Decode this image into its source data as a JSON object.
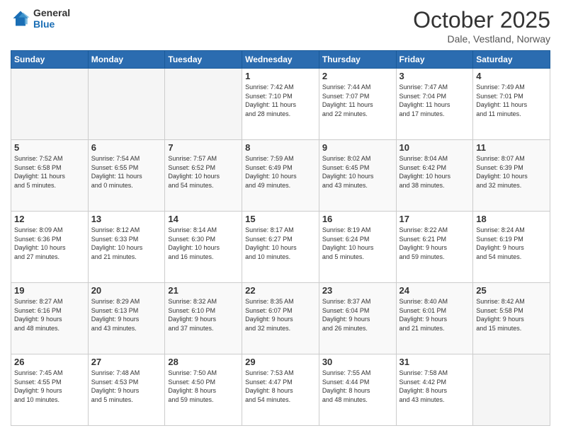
{
  "header": {
    "logo_general": "General",
    "logo_blue": "Blue",
    "main_title": "October 2025",
    "subtitle": "Dale, Vestland, Norway"
  },
  "days_of_week": [
    "Sunday",
    "Monday",
    "Tuesday",
    "Wednesday",
    "Thursday",
    "Friday",
    "Saturday"
  ],
  "weeks": [
    [
      {
        "day": "",
        "info": ""
      },
      {
        "day": "",
        "info": ""
      },
      {
        "day": "",
        "info": ""
      },
      {
        "day": "1",
        "info": "Sunrise: 7:42 AM\nSunset: 7:10 PM\nDaylight: 11 hours\nand 28 minutes."
      },
      {
        "day": "2",
        "info": "Sunrise: 7:44 AM\nSunset: 7:07 PM\nDaylight: 11 hours\nand 22 minutes."
      },
      {
        "day": "3",
        "info": "Sunrise: 7:47 AM\nSunset: 7:04 PM\nDaylight: 11 hours\nand 17 minutes."
      },
      {
        "day": "4",
        "info": "Sunrise: 7:49 AM\nSunset: 7:01 PM\nDaylight: 11 hours\nand 11 minutes."
      }
    ],
    [
      {
        "day": "5",
        "info": "Sunrise: 7:52 AM\nSunset: 6:58 PM\nDaylight: 11 hours\nand 5 minutes."
      },
      {
        "day": "6",
        "info": "Sunrise: 7:54 AM\nSunset: 6:55 PM\nDaylight: 11 hours\nand 0 minutes."
      },
      {
        "day": "7",
        "info": "Sunrise: 7:57 AM\nSunset: 6:52 PM\nDaylight: 10 hours\nand 54 minutes."
      },
      {
        "day": "8",
        "info": "Sunrise: 7:59 AM\nSunset: 6:49 PM\nDaylight: 10 hours\nand 49 minutes."
      },
      {
        "day": "9",
        "info": "Sunrise: 8:02 AM\nSunset: 6:45 PM\nDaylight: 10 hours\nand 43 minutes."
      },
      {
        "day": "10",
        "info": "Sunrise: 8:04 AM\nSunset: 6:42 PM\nDaylight: 10 hours\nand 38 minutes."
      },
      {
        "day": "11",
        "info": "Sunrise: 8:07 AM\nSunset: 6:39 PM\nDaylight: 10 hours\nand 32 minutes."
      }
    ],
    [
      {
        "day": "12",
        "info": "Sunrise: 8:09 AM\nSunset: 6:36 PM\nDaylight: 10 hours\nand 27 minutes."
      },
      {
        "day": "13",
        "info": "Sunrise: 8:12 AM\nSunset: 6:33 PM\nDaylight: 10 hours\nand 21 minutes."
      },
      {
        "day": "14",
        "info": "Sunrise: 8:14 AM\nSunset: 6:30 PM\nDaylight: 10 hours\nand 16 minutes."
      },
      {
        "day": "15",
        "info": "Sunrise: 8:17 AM\nSunset: 6:27 PM\nDaylight: 10 hours\nand 10 minutes."
      },
      {
        "day": "16",
        "info": "Sunrise: 8:19 AM\nSunset: 6:24 PM\nDaylight: 10 hours\nand 5 minutes."
      },
      {
        "day": "17",
        "info": "Sunrise: 8:22 AM\nSunset: 6:21 PM\nDaylight: 9 hours\nand 59 minutes."
      },
      {
        "day": "18",
        "info": "Sunrise: 8:24 AM\nSunset: 6:19 PM\nDaylight: 9 hours\nand 54 minutes."
      }
    ],
    [
      {
        "day": "19",
        "info": "Sunrise: 8:27 AM\nSunset: 6:16 PM\nDaylight: 9 hours\nand 48 minutes."
      },
      {
        "day": "20",
        "info": "Sunrise: 8:29 AM\nSunset: 6:13 PM\nDaylight: 9 hours\nand 43 minutes."
      },
      {
        "day": "21",
        "info": "Sunrise: 8:32 AM\nSunset: 6:10 PM\nDaylight: 9 hours\nand 37 minutes."
      },
      {
        "day": "22",
        "info": "Sunrise: 8:35 AM\nSunset: 6:07 PM\nDaylight: 9 hours\nand 32 minutes."
      },
      {
        "day": "23",
        "info": "Sunrise: 8:37 AM\nSunset: 6:04 PM\nDaylight: 9 hours\nand 26 minutes."
      },
      {
        "day": "24",
        "info": "Sunrise: 8:40 AM\nSunset: 6:01 PM\nDaylight: 9 hours\nand 21 minutes."
      },
      {
        "day": "25",
        "info": "Sunrise: 8:42 AM\nSunset: 5:58 PM\nDaylight: 9 hours\nand 15 minutes."
      }
    ],
    [
      {
        "day": "26",
        "info": "Sunrise: 7:45 AM\nSunset: 4:55 PM\nDaylight: 9 hours\nand 10 minutes."
      },
      {
        "day": "27",
        "info": "Sunrise: 7:48 AM\nSunset: 4:53 PM\nDaylight: 9 hours\nand 5 minutes."
      },
      {
        "day": "28",
        "info": "Sunrise: 7:50 AM\nSunset: 4:50 PM\nDaylight: 8 hours\nand 59 minutes."
      },
      {
        "day": "29",
        "info": "Sunrise: 7:53 AM\nSunset: 4:47 PM\nDaylight: 8 hours\nand 54 minutes."
      },
      {
        "day": "30",
        "info": "Sunrise: 7:55 AM\nSunset: 4:44 PM\nDaylight: 8 hours\nand 48 minutes."
      },
      {
        "day": "31",
        "info": "Sunrise: 7:58 AM\nSunset: 4:42 PM\nDaylight: 8 hours\nand 43 minutes."
      },
      {
        "day": "",
        "info": ""
      }
    ]
  ]
}
